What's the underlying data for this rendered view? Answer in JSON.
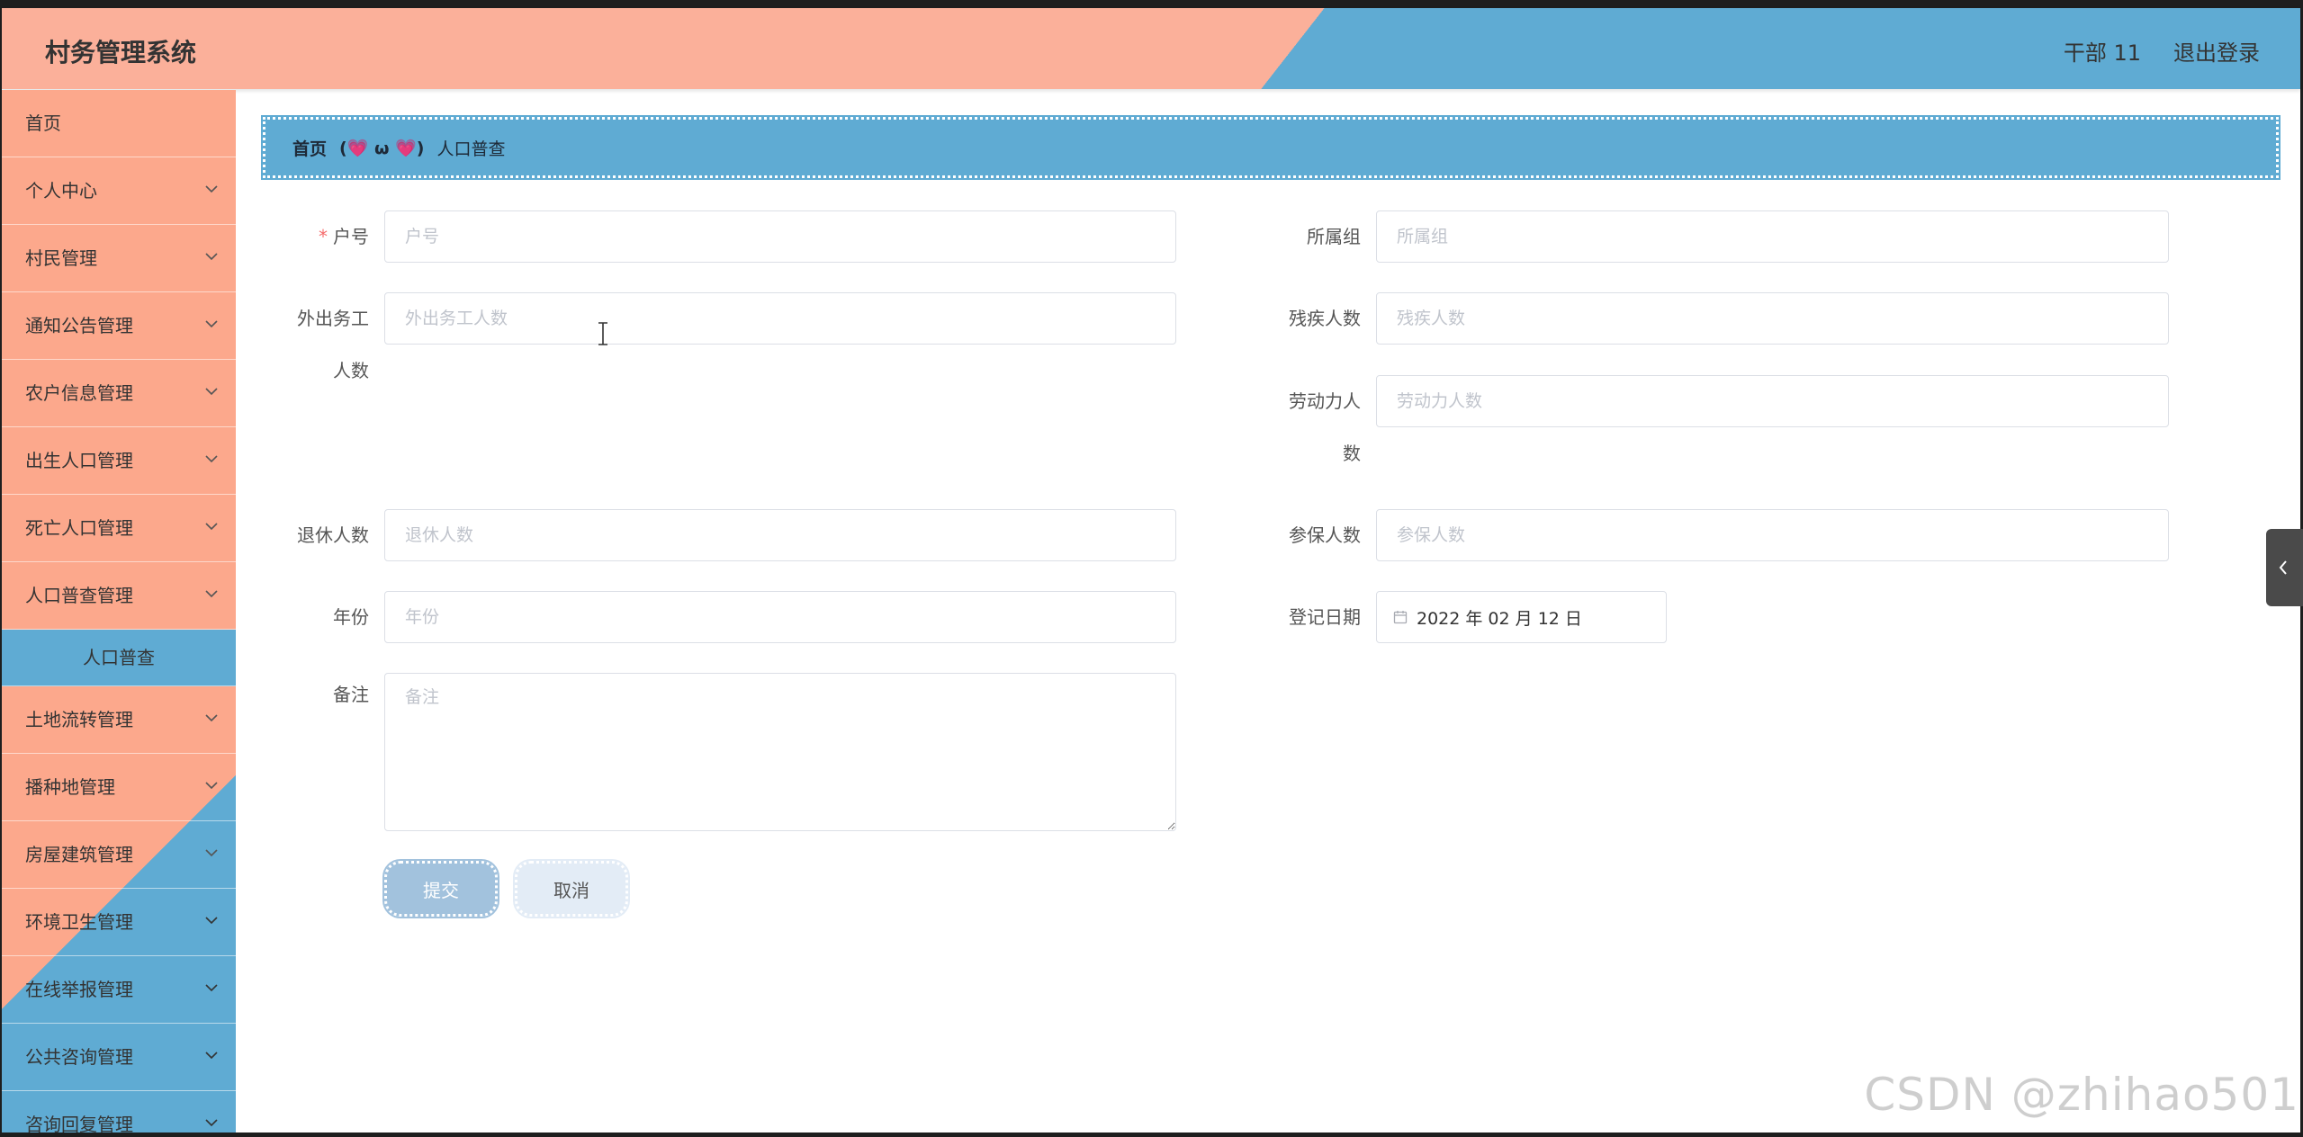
{
  "header": {
    "app_title": "村务管理系统",
    "user_label": "干部 11",
    "logout_label": "退出登录"
  },
  "colors": {
    "header_left": "#fbb09a",
    "header_right": "#5fabd3",
    "sidebar_bg": "#fca88c",
    "sidebar_active": "#5fabd3",
    "breadcrumb_bg": "#5fabd3",
    "submit_bg": "#a2c2dd",
    "cancel_bg": "#e3ecf6"
  },
  "sidebar": {
    "items": [
      {
        "label": "首页",
        "has_chevron": false
      },
      {
        "label": "个人中心",
        "has_chevron": true
      },
      {
        "label": "村民管理",
        "has_chevron": true
      },
      {
        "label": "通知公告管理",
        "has_chevron": true
      },
      {
        "label": "农户信息管理",
        "has_chevron": true
      },
      {
        "label": "出生人口管理",
        "has_chevron": true
      },
      {
        "label": "死亡人口管理",
        "has_chevron": true
      },
      {
        "label": "人口普查管理",
        "has_chevron": true
      },
      {
        "label": "土地流转管理",
        "has_chevron": true
      },
      {
        "label": "播种地管理",
        "has_chevron": true
      },
      {
        "label": "房屋建筑管理",
        "has_chevron": true
      },
      {
        "label": "环境卫生管理",
        "has_chevron": true
      },
      {
        "label": "在线举报管理",
        "has_chevron": true
      },
      {
        "label": "公共咨询管理",
        "has_chevron": true
      },
      {
        "label": "咨询回复管理",
        "has_chevron": true
      }
    ],
    "active_sub": "人口普查"
  },
  "breadcrumb": {
    "home": "首页",
    "separator": "(💗 ω 💗)",
    "current": "人口普查"
  },
  "form": {
    "huhao": {
      "label": "户号",
      "placeholder": "户号",
      "required": true
    },
    "suoshuzu": {
      "label": "所属组",
      "placeholder": "所属组"
    },
    "waichu": {
      "label_line1": "外出务工",
      "label_line2": "人数",
      "placeholder": "外出务工人数"
    },
    "canji": {
      "label": "残疾人数",
      "placeholder": "残疾人数"
    },
    "laodongli": {
      "label_line1": "劳动力人",
      "label_line2": "数",
      "placeholder": "劳动力人数"
    },
    "tuixiu": {
      "label": "退休人数",
      "placeholder": "退休人数"
    },
    "canbao": {
      "label": "参保人数",
      "placeholder": "参保人数"
    },
    "nianfen": {
      "label": "年份",
      "placeholder": "年份"
    },
    "dengji": {
      "label": "登记日期",
      "value": "2022 年 02 月 12 日"
    },
    "beizhu": {
      "label": "备注",
      "placeholder": "备注"
    },
    "submit_label": "提交",
    "cancel_label": "取消"
  },
  "icons": {
    "chevron": "chevron-down-icon",
    "calendar": "calendar-icon",
    "collapse": "chevron-left-icon",
    "cursor": "text-cursor-icon"
  },
  "watermark": "CSDN @zhihao501"
}
